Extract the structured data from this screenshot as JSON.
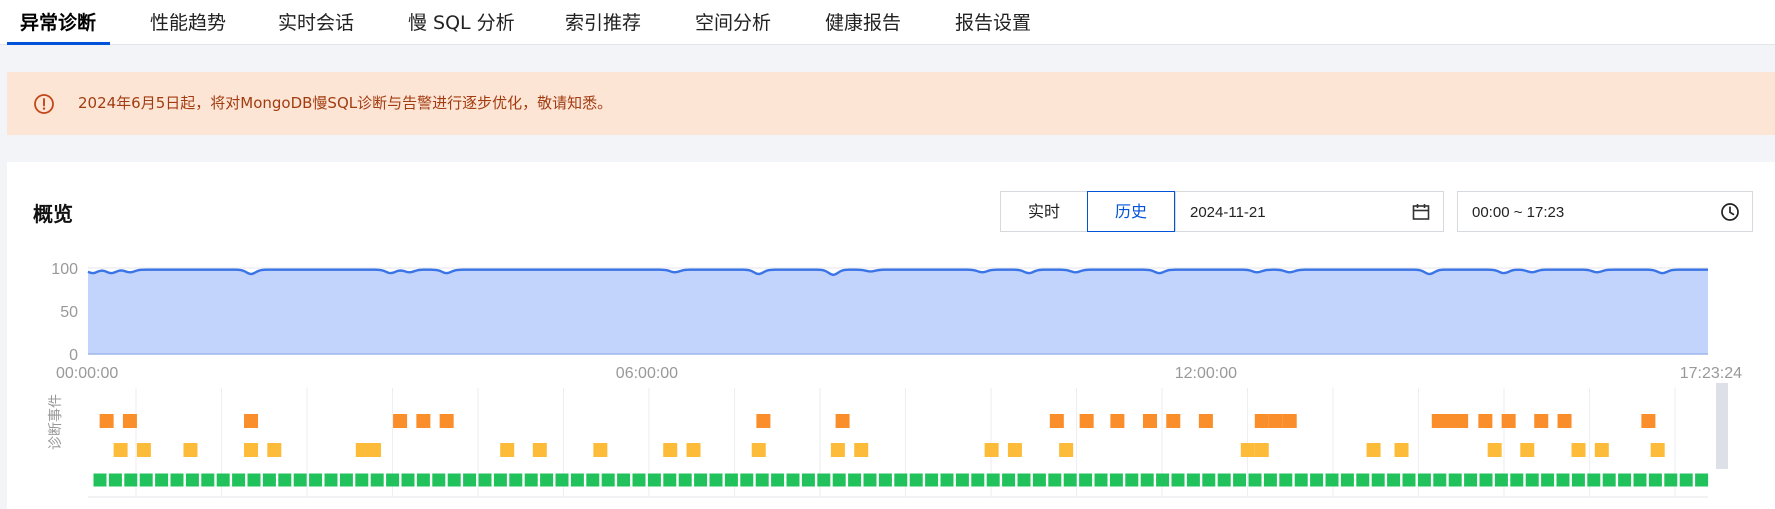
{
  "tabs": [
    {
      "label": "异常诊断",
      "active": true
    },
    {
      "label": "性能趋势"
    },
    {
      "label": "实时会话"
    },
    {
      "label": "慢 SQL 分析"
    },
    {
      "label": "索引推荐"
    },
    {
      "label": "空间分析"
    },
    {
      "label": "健康报告"
    },
    {
      "label": "报告设置"
    }
  ],
  "notice": {
    "icon": "alert-circle-icon",
    "text": "2024年6月5日起，将对MongoDB慢SQL诊断与告警进行逐步优化，敬请知悉。"
  },
  "overview": {
    "title": "概览",
    "realtime_label": "实时",
    "history_label": "历史",
    "date_value": "2024-11-21",
    "time_value": "00:00 ~ 17:23"
  },
  "colors": {
    "accent": "#0052d9",
    "area_fill": "#c2d4fb",
    "line": "#3a74e6",
    "event_orange": "#f98e2a",
    "event_yellow": "#fdbb3a",
    "event_green": "#21c25c",
    "notice_bg": "#fde5d6",
    "notice_text": "#a23c10"
  },
  "chart_data": [
    {
      "type": "area",
      "x_ticks": [
        "00:00:00",
        "06:00:00",
        "12:00:00",
        "17:23:24"
      ],
      "y_ticks": [
        "0",
        "50",
        "100"
      ],
      "ylim": [
        0,
        100
      ],
      "xlim_hours": [
        0,
        17.39
      ],
      "grid": true,
      "baseline": 98,
      "dips": [
        {
          "t": 0.05,
          "value": 94
        },
        {
          "t": 0.25,
          "value": 94
        },
        {
          "t": 0.45,
          "value": 95
        },
        {
          "t": 1.75,
          "value": 93
        },
        {
          "t": 3.25,
          "value": 94
        },
        {
          "t": 3.45,
          "value": 95
        },
        {
          "t": 3.85,
          "value": 94
        },
        {
          "t": 6.3,
          "value": 95
        },
        {
          "t": 7.2,
          "value": 93
        },
        {
          "t": 8.0,
          "value": 92
        },
        {
          "t": 8.4,
          "value": 96
        },
        {
          "t": 9.6,
          "value": 95
        },
        {
          "t": 10.1,
          "value": 94
        },
        {
          "t": 10.6,
          "value": 95
        },
        {
          "t": 11.5,
          "value": 94
        },
        {
          "t": 12.55,
          "value": 95
        },
        {
          "t": 12.9,
          "value": 95
        },
        {
          "t": 14.4,
          "value": 93
        },
        {
          "t": 15.2,
          "value": 94
        },
        {
          "t": 15.5,
          "value": 95
        },
        {
          "t": 16.2,
          "value": 95
        },
        {
          "t": 16.9,
          "value": 94
        }
      ]
    },
    {
      "type": "scatter",
      "ylabel": "诊断事件",
      "rows": [
        "high",
        "medium",
        "normal"
      ],
      "normal_row_continuous": true,
      "events": [
        {
          "t": 0.2,
          "row": "high"
        },
        {
          "t": 0.45,
          "row": "high"
        },
        {
          "t": 1.75,
          "row": "high"
        },
        {
          "t": 3.35,
          "row": "high"
        },
        {
          "t": 3.6,
          "row": "high"
        },
        {
          "t": 3.85,
          "row": "high"
        },
        {
          "t": 7.25,
          "row": "high"
        },
        {
          "t": 8.1,
          "row": "high"
        },
        {
          "t": 10.4,
          "row": "high"
        },
        {
          "t": 10.72,
          "row": "high"
        },
        {
          "t": 11.05,
          "row": "high"
        },
        {
          "t": 11.4,
          "row": "high"
        },
        {
          "t": 11.65,
          "row": "high"
        },
        {
          "t": 12.0,
          "row": "high"
        },
        {
          "t": 12.6,
          "row": "high"
        },
        {
          "t": 12.75,
          "row": "high"
        },
        {
          "t": 12.9,
          "row": "high"
        },
        {
          "t": 14.5,
          "row": "high"
        },
        {
          "t": 14.62,
          "row": "high"
        },
        {
          "t": 14.74,
          "row": "high"
        },
        {
          "t": 15.0,
          "row": "high"
        },
        {
          "t": 15.25,
          "row": "high"
        },
        {
          "t": 15.6,
          "row": "high"
        },
        {
          "t": 15.85,
          "row": "high"
        },
        {
          "t": 16.75,
          "row": "high"
        },
        {
          "t": 0.35,
          "row": "medium"
        },
        {
          "t": 0.6,
          "row": "medium"
        },
        {
          "t": 1.1,
          "row": "medium"
        },
        {
          "t": 1.75,
          "row": "medium"
        },
        {
          "t": 2.0,
          "row": "medium"
        },
        {
          "t": 2.95,
          "row": "medium"
        },
        {
          "t": 3.07,
          "row": "medium"
        },
        {
          "t": 4.5,
          "row": "medium"
        },
        {
          "t": 4.85,
          "row": "medium"
        },
        {
          "t": 5.5,
          "row": "medium"
        },
        {
          "t": 6.25,
          "row": "medium"
        },
        {
          "t": 6.5,
          "row": "medium"
        },
        {
          "t": 7.2,
          "row": "medium"
        },
        {
          "t": 8.05,
          "row": "medium"
        },
        {
          "t": 8.3,
          "row": "medium"
        },
        {
          "t": 9.7,
          "row": "medium"
        },
        {
          "t": 9.95,
          "row": "medium"
        },
        {
          "t": 10.5,
          "row": "medium"
        },
        {
          "t": 12.45,
          "row": "medium"
        },
        {
          "t": 12.6,
          "row": "medium"
        },
        {
          "t": 13.8,
          "row": "medium"
        },
        {
          "t": 14.1,
          "row": "medium"
        },
        {
          "t": 15.1,
          "row": "medium"
        },
        {
          "t": 15.45,
          "row": "medium"
        },
        {
          "t": 16.0,
          "row": "medium"
        },
        {
          "t": 16.25,
          "row": "medium"
        },
        {
          "t": 16.85,
          "row": "medium"
        }
      ]
    }
  ]
}
